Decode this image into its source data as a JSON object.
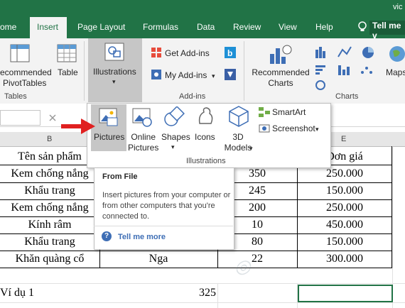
{
  "title_fragment": "vic",
  "tabs": [
    "ome",
    "Insert",
    "Page Layout",
    "Formulas",
    "Data",
    "Review",
    "View",
    "Help"
  ],
  "tell_me": "Tell me v",
  "ribbon": {
    "recommended_pivot": [
      "ecommended",
      "PivotTables"
    ],
    "table": "Table",
    "illustrations": "Illustrations",
    "get_addins": "Get Add-ins",
    "my_addins": "My Add-ins",
    "recommended_charts": [
      "Recommended",
      "Charts"
    ],
    "maps": "Maps",
    "groups": {
      "tables": "Tables",
      "addins": "Add-ins",
      "charts": "Charts"
    }
  },
  "dropdown": {
    "pictures": "Pictures",
    "online_pictures": [
      "Online",
      "Pictures"
    ],
    "shapes": "Shapes",
    "icons": "Icons",
    "models_3d": [
      "3D",
      "Models"
    ],
    "smartart": "SmartArt",
    "screenshot": "Screenshot",
    "group_label": "Illustrations"
  },
  "tooltip": {
    "title": "From File",
    "body": "Insert pictures from your computer or from other computers that you're connected to.",
    "tell_more": "Tell me more"
  },
  "columns": [
    "B",
    "E"
  ],
  "table": {
    "header": [
      "Tên sản phẩm",
      "Đơn giá"
    ],
    "rows": [
      {
        "name": "Kem chống nắng",
        "qty": "350",
        "price": "250.000"
      },
      {
        "name": "Khẩu trang",
        "qty": "245",
        "price": "150.000"
      },
      {
        "name": "Kem chống nắng",
        "qty": "200",
        "price": "250.000"
      },
      {
        "name": "Kính râm",
        "qty": "10",
        "price": "450.000"
      },
      {
        "name": "Khẩu trang",
        "qty": "80",
        "price": "150.000"
      },
      {
        "name": "Khăn quàng cổ",
        "seller": "Nga",
        "qty": "22",
        "price": "300.000"
      }
    ],
    "footer_label": "Ví dụ 1",
    "footer_value": "325"
  },
  "colors": {
    "excel_green": "#217346",
    "arrow_red": "#e02020",
    "link_blue": "#3e6eb5"
  }
}
